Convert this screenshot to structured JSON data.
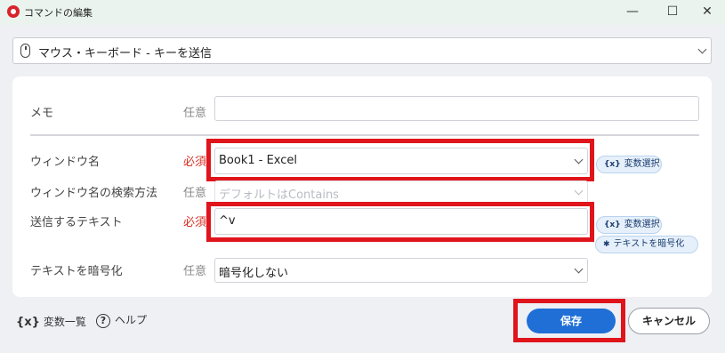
{
  "window": {
    "title": "コマンドの編集",
    "minimize_glyph": "—",
    "maximize_glyph": "☐",
    "close_glyph": "✕"
  },
  "command_select": {
    "value": "マウス・キーボード - キーを送信",
    "icon": "mouse-icon"
  },
  "fields": {
    "memo": {
      "label": "メモ",
      "requirement": "任意",
      "value": ""
    },
    "window_name": {
      "label": "ウィンドウ名",
      "requirement": "必須",
      "value": "Book1 - Excel"
    },
    "search_method": {
      "label": "ウィンドウ名の検索方法",
      "requirement": "任意",
      "placeholder": "デフォルトはContains"
    },
    "send_text": {
      "label": "送信するテキスト",
      "requirement": "必須",
      "value": "^v"
    },
    "encrypt": {
      "label": "テキストを暗号化",
      "requirement": "任意",
      "value": "暗号化しない"
    }
  },
  "pills": {
    "var_select_icon": "{x}",
    "var_select_label": "変数選択",
    "encrypt_icon": "✱",
    "encrypt_label": "テキストを暗号化"
  },
  "footer": {
    "var_list_icon": "{x}",
    "var_list_label": "変数一覧",
    "help_icon": "?",
    "help_label": "ヘルプ",
    "save_label": "保存",
    "cancel_label": "キャンセル"
  },
  "colors": {
    "required": "#d93025",
    "highlight": "#e0141b",
    "primary": "#1f6fd6"
  }
}
